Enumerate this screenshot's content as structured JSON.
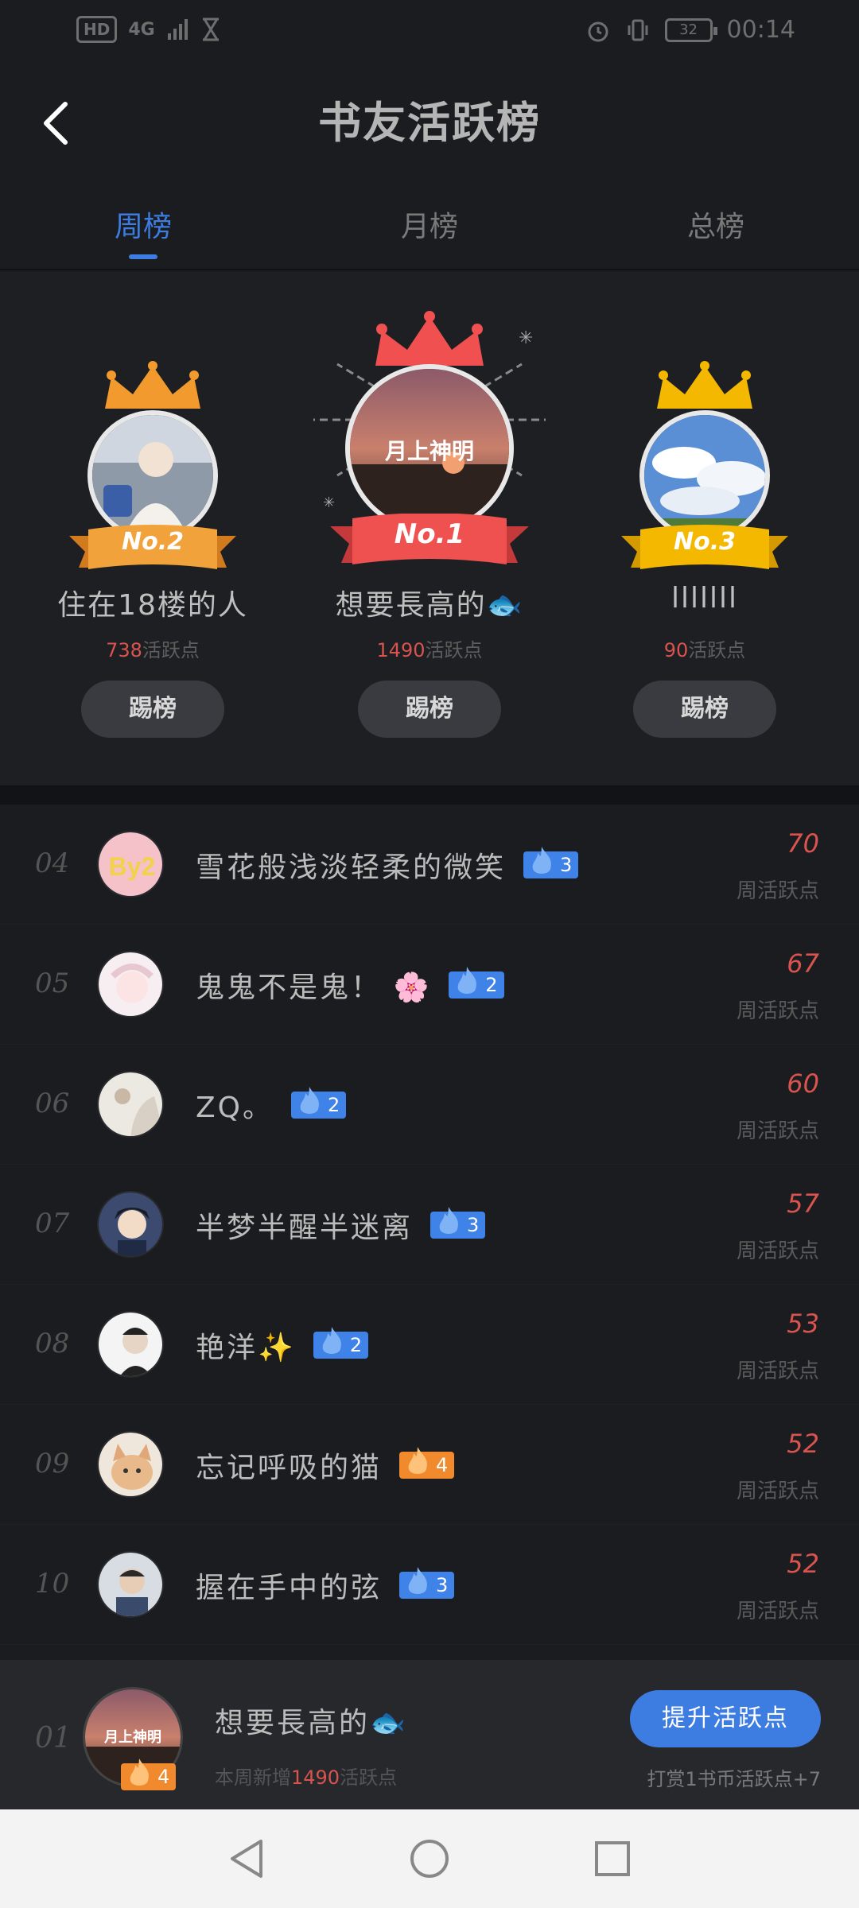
{
  "status_bar": {
    "network_badge": "HD",
    "signal": "4G",
    "battery": "32",
    "time": "00:14"
  },
  "header": {
    "title": "书友活跃榜"
  },
  "tabs": [
    {
      "label": "周榜",
      "active": true
    },
    {
      "label": "月榜",
      "active": false
    },
    {
      "label": "总榜",
      "active": false
    }
  ],
  "podium": {
    "second": {
      "badge": "No.2",
      "name": "住在18楼的人",
      "points": "738",
      "points_suffix": "活跃点",
      "button": "踢榜"
    },
    "first": {
      "badge": "No.1",
      "name": "想要長高的🐟",
      "points": "1490",
      "points_suffix": "活跃点",
      "button": "踢榜",
      "avatar_caption": "月上神明"
    },
    "third": {
      "badge": "No.3",
      "name": "lllllll",
      "points": "90",
      "points_suffix": "活跃点",
      "button": "踢榜"
    }
  },
  "list": [
    {
      "rank": "04",
      "name": "雪花般浅淡轻柔的微笑",
      "badge_level": "3",
      "badge_color": "#3f82e8",
      "score": "70",
      "score_label": "周活跃点",
      "avatar_text": "By2"
    },
    {
      "rank": "05",
      "name": "鬼鬼不是鬼！ 🌸",
      "badge_level": "2",
      "badge_color": "#3f82e8",
      "score": "67",
      "score_label": "周活跃点"
    },
    {
      "rank": "06",
      "name": "ZQ。",
      "badge_level": "2",
      "badge_color": "#3f82e8",
      "score": "60",
      "score_label": "周活跃点"
    },
    {
      "rank": "07",
      "name": "半梦半醒半迷离",
      "badge_level": "3",
      "badge_color": "#3f82e8",
      "score": "57",
      "score_label": "周活跃点"
    },
    {
      "rank": "08",
      "name": "艳洋✨",
      "badge_level": "2",
      "badge_color": "#3f82e8",
      "score": "53",
      "score_label": "周活跃点"
    },
    {
      "rank": "09",
      "name": "忘记呼吸的猫",
      "badge_level": "4",
      "badge_color": "#f08a2c",
      "score": "52",
      "score_label": "周活跃点"
    },
    {
      "rank": "10",
      "name": "握在手中的弦",
      "badge_level": "3",
      "badge_color": "#3f82e8",
      "score": "52",
      "score_label": "周活跃点"
    }
  ],
  "my_rank": {
    "rank": "01",
    "name": "想要長高的🐟",
    "badge_level": "4",
    "avatar_caption": "月上神明",
    "week_prefix": "本周新增",
    "week_points": "1490",
    "week_suffix": "活跃点",
    "button": "提升活跃点",
    "tip": "打赏1书币活跃点+7"
  }
}
